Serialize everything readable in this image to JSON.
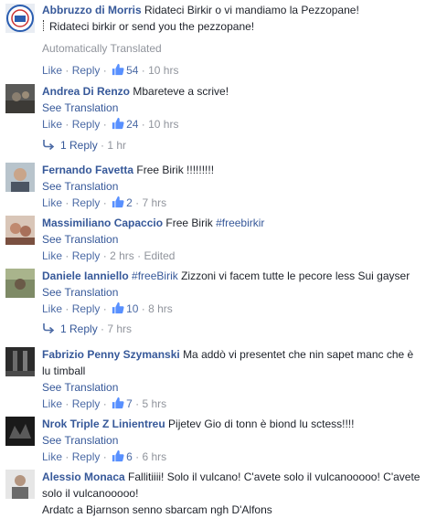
{
  "dot": "·",
  "see_translation": "See Translation",
  "like": "Like",
  "reply": "Reply",
  "comments": [
    {
      "author": "Abbruzzo di Morris",
      "text": "Ridateci Birkir o vi mandiamo la Pezzopane!",
      "translation": "Ridateci birkir or send you the pezzopane!",
      "auto_translated": "Automatically Translated",
      "likes": "54",
      "time": "10 hrs"
    },
    {
      "author": "Andrea Di Renzo",
      "text": "Mbareteve a scrive!",
      "likes": "24",
      "time": "10 hrs",
      "replies": "1 Reply",
      "reply_time": "1 hr"
    },
    {
      "author": "Fernando Favetta",
      "text": "Free Birik !!!!!!!!!",
      "likes": "2",
      "time": "7 hrs"
    },
    {
      "author": "Massimiliano Capaccio",
      "text": "Free Birik",
      "hashtag": "#freebirkir",
      "time": "2 hrs",
      "edited": "Edited"
    },
    {
      "author": "Daniele Ianniello",
      "hashtag": "#freeBirik",
      "text": "Zizzoni vi facem tutte le pecore less Sui gayser",
      "likes": "10",
      "time": "8 hrs",
      "replies": "1 Reply",
      "reply_time": "7 hrs"
    },
    {
      "author": "Fabrizio Penny Szymanski",
      "text": "Ma addò vi presentet che nin sapet manc che è lu timball",
      "likes": "7",
      "time": "5 hrs"
    },
    {
      "author": "Nrok Triple Z Linientreu",
      "text": "Pijetev Gio di tonn è biond lu sctess!!!!",
      "likes": "6",
      "time": "6 hrs"
    },
    {
      "author": "Alessio Monaca",
      "text": "Fallitiiii! Solo il vulcano! C'avete solo il vulcanooooo! C'avete solo il vulcanooooo!",
      "text2": "Ardatc a Bjarnson senno sbarcam ngh D'Alfons"
    }
  ],
  "colors": {
    "link": "#365899",
    "text": "#1d2129",
    "meta": "#90949c"
  }
}
